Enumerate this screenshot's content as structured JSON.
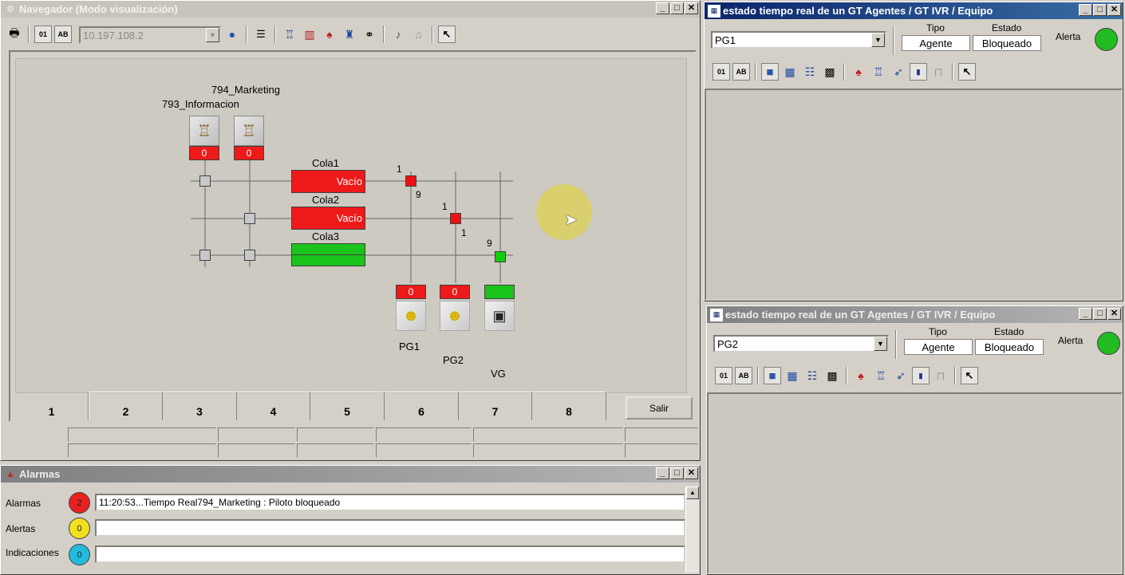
{
  "navigator": {
    "title": "Navegador (Modo visualización)",
    "ip": "10.197.108.2",
    "icons": [
      "printer-icon",
      "counter-01-icon",
      "counter-ab-icon",
      "globe-icon",
      "sliders-icon",
      "hierarchy-icon",
      "bar-chart-icon",
      "agent-icon",
      "network-icon",
      "binoculars-icon",
      "volume-icon",
      "volume-mute-icon",
      "back-arrow-icon"
    ],
    "groups": {
      "g1": "794_Marketing",
      "g2": "793_Informacion"
    },
    "gauge_counts": [
      "0",
      "0"
    ],
    "queues": [
      {
        "name": "Cola1",
        "status": "Vacío",
        "color": "red"
      },
      {
        "name": "Cola2",
        "status": "Vacío",
        "color": "red"
      },
      {
        "name": "Cola3",
        "status": "",
        "color": "green"
      }
    ],
    "junction_numbers": {
      "j1_top": "1",
      "j1_bot": "9",
      "j2_top": "1",
      "j2_bot": "1",
      "j3_top": "9"
    },
    "endpoints": [
      {
        "name": "PG1",
        "count": "0",
        "color": "red",
        "icon": "agents-icon"
      },
      {
        "name": "PG2",
        "count": "0",
        "color": "red",
        "icon": "agents-icon"
      },
      {
        "name": "VG",
        "count": "",
        "color": "green",
        "icon": "voice-gateway-icon"
      }
    ],
    "tabs": [
      "1",
      "2",
      "3",
      "4",
      "5",
      "6",
      "7",
      "8"
    ],
    "exit_label": "Salir"
  },
  "rt_windows": [
    {
      "title": "estado tiempo real de un GT Agentes / GT IVR / Equipo",
      "selected": "PG1",
      "tipo_label": "Tipo",
      "tipo_value": "Agente",
      "estado_label": "Estado",
      "estado_value": "Bloqueado",
      "alerta_label": "Alerta",
      "alert_color": "#22bb22"
    },
    {
      "title": "estado tiempo real de un GT Agentes / GT IVR / Equipo",
      "selected": "PG2",
      "tipo_label": "Tipo",
      "tipo_value": "Agente",
      "estado_label": "Estado",
      "estado_value": "Bloqueado",
      "alerta_label": "Alerta",
      "alert_color": "#22bb22"
    }
  ],
  "alarms": {
    "title": "Alarmas",
    "rows": [
      {
        "label": "Alarmas",
        "count": "2",
        "color": "#e82020",
        "text": "11:20:53...Tiempo Real794_Marketing : Piloto bloqueado"
      },
      {
        "label": "Alertas",
        "count": "0",
        "color": "#f0e020",
        "text": ""
      },
      {
        "label": "Indicaciones",
        "count": "0",
        "color": "#22bbdd",
        "text": ""
      }
    ]
  }
}
